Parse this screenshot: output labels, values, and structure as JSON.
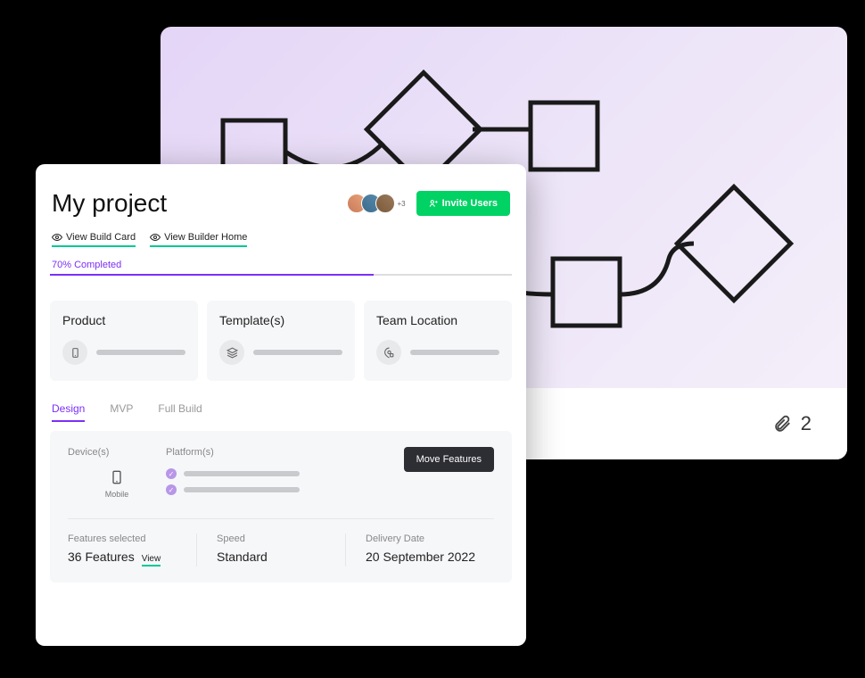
{
  "diagram": {
    "attachment_count": "2"
  },
  "project": {
    "title": "My project",
    "avatar_more": "+3",
    "invite_label": "Invite Users",
    "links": {
      "build_card": "View Build Card",
      "builder_home": "View Builder Home"
    },
    "progress": {
      "label": "70% Completed",
      "percent": 70
    },
    "summary": {
      "product": "Product",
      "templates": "Template(s)",
      "team_location": "Team Location"
    },
    "tabs": {
      "design": "Design",
      "mvp": "MVP",
      "full_build": "Full Build"
    },
    "design": {
      "devices_label": "Device(s)",
      "device_name": "Mobile",
      "platforms_label": "Platform(s)",
      "move_features": "Move Features",
      "features_label": "Features selected",
      "features_value": "36 Features",
      "features_view": "View",
      "speed_label": "Speed",
      "speed_value": "Standard",
      "delivery_label": "Delivery Date",
      "delivery_value": "20 September 2022"
    }
  }
}
